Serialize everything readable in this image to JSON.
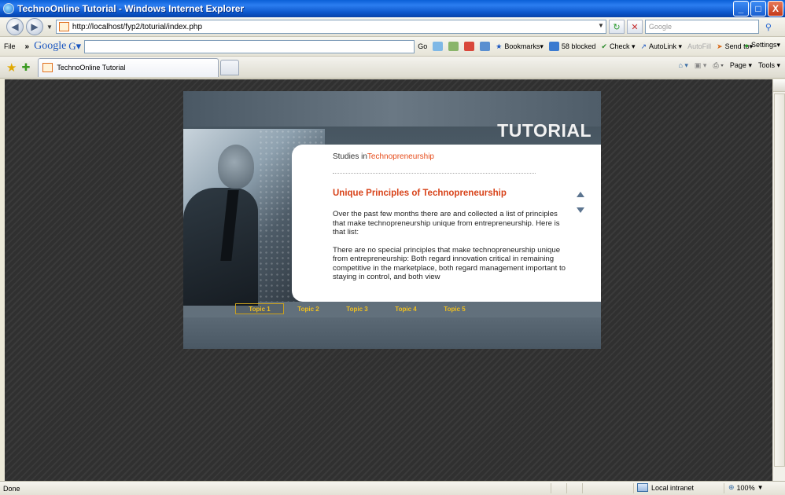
{
  "window": {
    "title": "TechnoOnline Tutorial - Windows Internet Explorer",
    "minimize": "_",
    "maximize": "□",
    "close": "X"
  },
  "address_bar": {
    "url": "http://localhost/fyp2/toturial/index.php",
    "search_placeholder": "Google"
  },
  "google_toolbar": {
    "file_menu": "File",
    "chevron": "»",
    "logo": "Google",
    "g_button": "G▾",
    "go_label": "Go",
    "bookmarks_label": "Bookmarks▾",
    "blocked_label": "58 blocked",
    "check_label": "Check ▾",
    "autolink_label": "AutoLink ▾",
    "autofill_label": "AutoFill",
    "sendto_label": "Send to▾",
    "settings_label": "Settings▾"
  },
  "tabs": {
    "active_tab_label": "TechnoOnline Tutorial"
  },
  "command_bar": {
    "page_label": "Page ▾",
    "tools_label": "Tools ▾"
  },
  "tutorial": {
    "header": "TUTORIAL",
    "studies_prefix": "Studies in",
    "studies_highlight": "Technopreneurship",
    "lesson_title": "Unique Principles of Technopreneurship",
    "paragraph_1": "Over the past few months there are and collected a list of principles that make technopreneurship unique from entrepreneurship. Here is that list:",
    "paragraph_2": "There are no special principles that make technopreneurship unique from entrepreneurship: Both regard innovation critical in remaining competitive in the marketplace, both regard management important to staying in control, and both view",
    "topics": [
      "Topic 1",
      "Topic 2",
      "Topic 3",
      "Topic 4",
      "Topic 5"
    ],
    "active_topic_index": 0
  },
  "status_bar": {
    "status": "Done",
    "zone": "Local intranet",
    "zoom": "100%"
  },
  "colors": {
    "accent_orange": "#d8431a",
    "topic_yellow": "#f0c020",
    "titlebar_blue": "#0b55c9"
  }
}
